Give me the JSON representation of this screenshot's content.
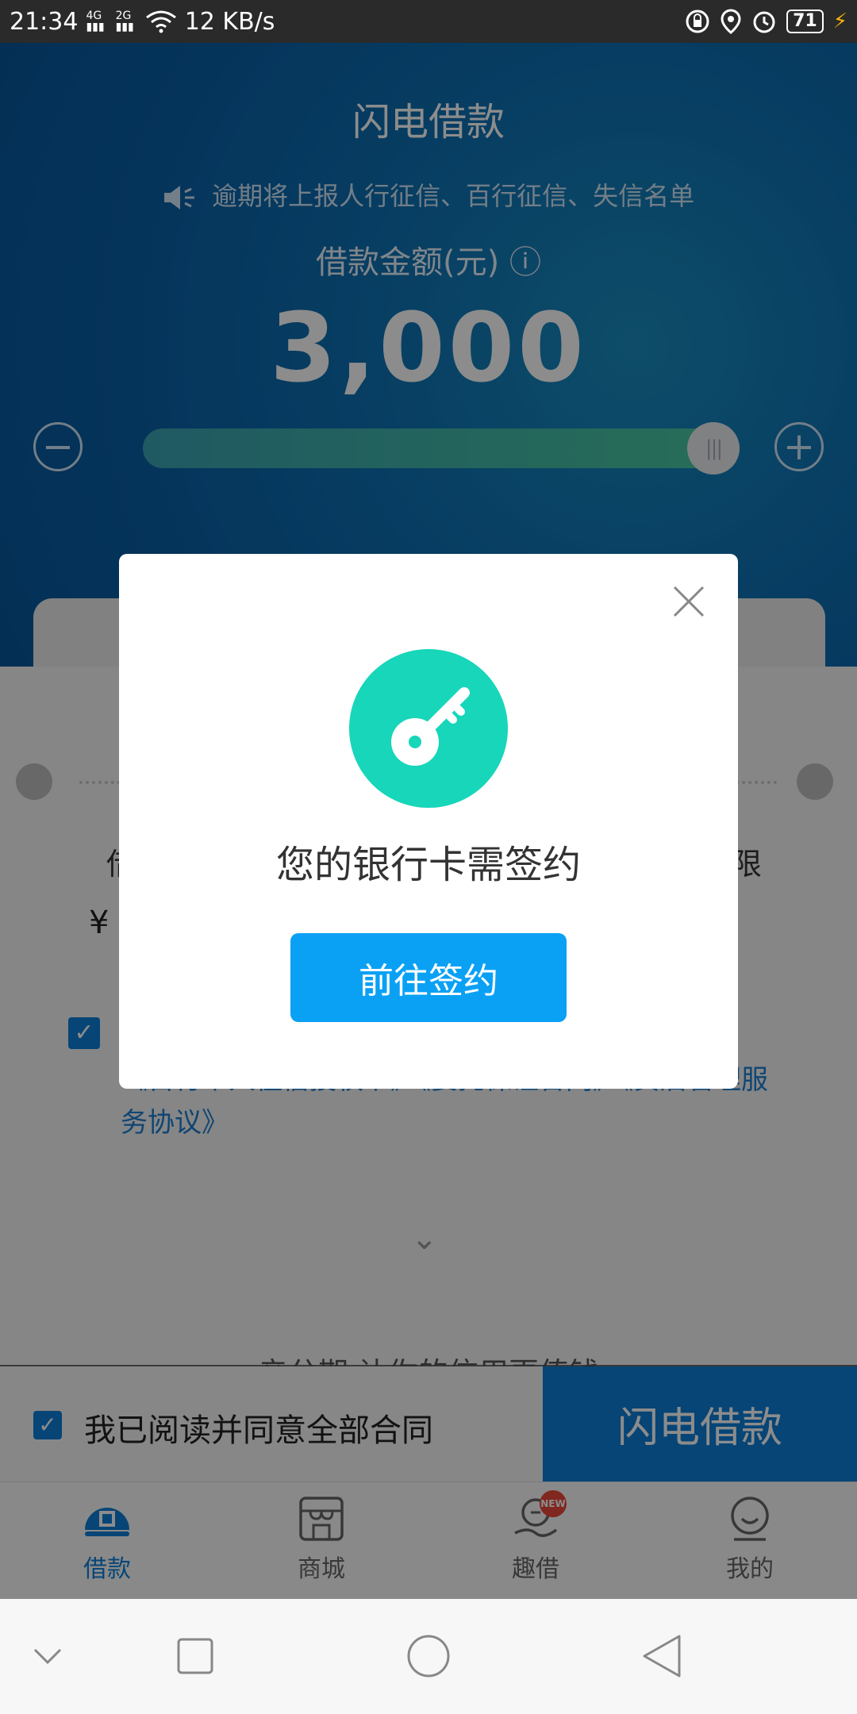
{
  "status_bar": {
    "time": "21:34",
    "net1": "4G",
    "net2": "2G",
    "speed": "12 KB/s",
    "battery": "71"
  },
  "hero": {
    "title": "闪电借款",
    "notice": "逾期将上报人行征信、百行征信、失信名单",
    "amount_label": "借款金额(元) ⓘ",
    "amount": "3,000",
    "slider_fraction": 1.0
  },
  "card": {
    "peek_left1": "借",
    "peek_right1": "限",
    "peek_left2": "¥",
    "contracts_text": "《百行个人征信授权书》《委托保证合同》《贷后管理服务协议》"
  },
  "slogan": "亲分期 让你的信用更值钱",
  "bottom_action": {
    "agree_text": "我已阅读并同意全部合同",
    "button": "闪电借款"
  },
  "tabs": [
    {
      "label": "借款",
      "icon": "loan-icon",
      "active": true
    },
    {
      "label": "商城",
      "icon": "store-icon",
      "active": false
    },
    {
      "label": "趣借",
      "icon": "fun-loan-icon",
      "active": false,
      "badge": "NEW"
    },
    {
      "label": "我的",
      "icon": "profile-icon",
      "active": false
    }
  ],
  "modal": {
    "message": "您的银行卡需签约",
    "button": "前往签约",
    "icon": "key-icon"
  },
  "colors": {
    "primary": "#0c7fd8",
    "modal_button": "#0aa1f5",
    "key_circle": "#17d6b9"
  }
}
